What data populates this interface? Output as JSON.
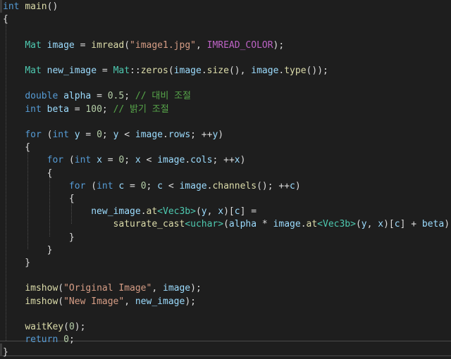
{
  "code": {
    "lines": [
      [
        {
          "c": "kw",
          "t": "int"
        },
        {
          "c": "pl",
          "t": " "
        },
        {
          "c": "fn",
          "t": "main"
        },
        {
          "c": "pl",
          "t": "()"
        }
      ],
      [
        {
          "c": "pl",
          "t": "{"
        }
      ],
      [],
      [
        {
          "c": "pl",
          "t": "    "
        },
        {
          "c": "ty",
          "t": "Mat"
        },
        {
          "c": "pl",
          "t": " "
        },
        {
          "c": "id",
          "t": "image"
        },
        {
          "c": "pl",
          "t": " = "
        },
        {
          "c": "fn",
          "t": "imread"
        },
        {
          "c": "pl",
          "t": "("
        },
        {
          "c": "st",
          "t": "\"image1.jpg\""
        },
        {
          "c": "pl",
          "t": ", "
        },
        {
          "c": "mc",
          "t": "IMREAD_COLOR"
        },
        {
          "c": "pl",
          "t": ");"
        }
      ],
      [],
      [
        {
          "c": "pl",
          "t": "    "
        },
        {
          "c": "ty",
          "t": "Mat"
        },
        {
          "c": "pl",
          "t": " "
        },
        {
          "c": "id",
          "t": "new_image"
        },
        {
          "c": "pl",
          "t": " = "
        },
        {
          "c": "ty",
          "t": "Mat"
        },
        {
          "c": "pl",
          "t": "::"
        },
        {
          "c": "fn",
          "t": "zeros"
        },
        {
          "c": "pl",
          "t": "("
        },
        {
          "c": "id",
          "t": "image"
        },
        {
          "c": "pl",
          "t": "."
        },
        {
          "c": "fn",
          "t": "size"
        },
        {
          "c": "pl",
          "t": "(), "
        },
        {
          "c": "id",
          "t": "image"
        },
        {
          "c": "pl",
          "t": "."
        },
        {
          "c": "fn",
          "t": "type"
        },
        {
          "c": "pl",
          "t": "());"
        }
      ],
      [],
      [
        {
          "c": "pl",
          "t": "    "
        },
        {
          "c": "kw",
          "t": "double"
        },
        {
          "c": "pl",
          "t": " "
        },
        {
          "c": "id",
          "t": "alpha"
        },
        {
          "c": "pl",
          "t": " = "
        },
        {
          "c": "nm",
          "t": "0.5"
        },
        {
          "c": "pl",
          "t": "; "
        },
        {
          "c": "cm",
          "t": "// 대비 조절"
        }
      ],
      [
        {
          "c": "pl",
          "t": "    "
        },
        {
          "c": "kw",
          "t": "int"
        },
        {
          "c": "pl",
          "t": " "
        },
        {
          "c": "id",
          "t": "beta"
        },
        {
          "c": "pl",
          "t": " = "
        },
        {
          "c": "nm",
          "t": "100"
        },
        {
          "c": "pl",
          "t": "; "
        },
        {
          "c": "cm",
          "t": "// 밝기 조절"
        }
      ],
      [],
      [
        {
          "c": "pl",
          "t": "    "
        },
        {
          "c": "kw",
          "t": "for"
        },
        {
          "c": "pl",
          "t": " ("
        },
        {
          "c": "kw",
          "t": "int"
        },
        {
          "c": "pl",
          "t": " "
        },
        {
          "c": "id",
          "t": "y"
        },
        {
          "c": "pl",
          "t": " = "
        },
        {
          "c": "nm",
          "t": "0"
        },
        {
          "c": "pl",
          "t": "; "
        },
        {
          "c": "id",
          "t": "y"
        },
        {
          "c": "pl",
          "t": " < "
        },
        {
          "c": "id",
          "t": "image"
        },
        {
          "c": "pl",
          "t": "."
        },
        {
          "c": "id",
          "t": "rows"
        },
        {
          "c": "pl",
          "t": "; ++"
        },
        {
          "c": "id",
          "t": "y"
        },
        {
          "c": "pl",
          "t": ")"
        }
      ],
      [
        {
          "c": "pl",
          "t": "    {"
        }
      ],
      [
        {
          "c": "pl",
          "t": "        "
        },
        {
          "c": "kw",
          "t": "for"
        },
        {
          "c": "pl",
          "t": " ("
        },
        {
          "c": "kw",
          "t": "int"
        },
        {
          "c": "pl",
          "t": " "
        },
        {
          "c": "id",
          "t": "x"
        },
        {
          "c": "pl",
          "t": " = "
        },
        {
          "c": "nm",
          "t": "0"
        },
        {
          "c": "pl",
          "t": "; "
        },
        {
          "c": "id",
          "t": "x"
        },
        {
          "c": "pl",
          "t": " < "
        },
        {
          "c": "id",
          "t": "image"
        },
        {
          "c": "pl",
          "t": "."
        },
        {
          "c": "id",
          "t": "cols"
        },
        {
          "c": "pl",
          "t": "; ++"
        },
        {
          "c": "id",
          "t": "x"
        },
        {
          "c": "pl",
          "t": ")"
        }
      ],
      [
        {
          "c": "pl",
          "t": "        {"
        }
      ],
      [
        {
          "c": "pl",
          "t": "            "
        },
        {
          "c": "kw",
          "t": "for"
        },
        {
          "c": "pl",
          "t": " ("
        },
        {
          "c": "kw",
          "t": "int"
        },
        {
          "c": "pl",
          "t": " "
        },
        {
          "c": "id",
          "t": "c"
        },
        {
          "c": "pl",
          "t": " = "
        },
        {
          "c": "nm",
          "t": "0"
        },
        {
          "c": "pl",
          "t": "; "
        },
        {
          "c": "id",
          "t": "c"
        },
        {
          "c": "pl",
          "t": " < "
        },
        {
          "c": "id",
          "t": "image"
        },
        {
          "c": "pl",
          "t": "."
        },
        {
          "c": "fn",
          "t": "channels"
        },
        {
          "c": "pl",
          "t": "(); ++"
        },
        {
          "c": "id",
          "t": "c"
        },
        {
          "c": "pl",
          "t": ")"
        }
      ],
      [
        {
          "c": "pl",
          "t": "            {"
        }
      ],
      [
        {
          "c": "pl",
          "t": "                "
        },
        {
          "c": "id",
          "t": "new_image"
        },
        {
          "c": "pl",
          "t": "."
        },
        {
          "c": "fn",
          "t": "at"
        },
        {
          "c": "ty",
          "t": "<Vec3b>"
        },
        {
          "c": "pl",
          "t": "("
        },
        {
          "c": "id",
          "t": "y"
        },
        {
          "c": "pl",
          "t": ", "
        },
        {
          "c": "id",
          "t": "x"
        },
        {
          "c": "pl",
          "t": ")["
        },
        {
          "c": "id",
          "t": "c"
        },
        {
          "c": "pl",
          "t": "] ="
        }
      ],
      [
        {
          "c": "pl",
          "t": "                    "
        },
        {
          "c": "fn",
          "t": "saturate_cast"
        },
        {
          "c": "ty",
          "t": "<uchar>"
        },
        {
          "c": "pl",
          "t": "("
        },
        {
          "c": "id",
          "t": "alpha"
        },
        {
          "c": "pl",
          "t": " * "
        },
        {
          "c": "id",
          "t": "image"
        },
        {
          "c": "pl",
          "t": "."
        },
        {
          "c": "fn",
          "t": "at"
        },
        {
          "c": "ty",
          "t": "<Vec3b>"
        },
        {
          "c": "pl",
          "t": "("
        },
        {
          "c": "id",
          "t": "y"
        },
        {
          "c": "pl",
          "t": ", "
        },
        {
          "c": "id",
          "t": "x"
        },
        {
          "c": "pl",
          "t": ")["
        },
        {
          "c": "id",
          "t": "c"
        },
        {
          "c": "pl",
          "t": "] + "
        },
        {
          "c": "id",
          "t": "beta"
        },
        {
          "c": "pl",
          "t": ");"
        }
      ],
      [
        {
          "c": "pl",
          "t": "            }"
        }
      ],
      [
        {
          "c": "pl",
          "t": "        }"
        }
      ],
      [
        {
          "c": "pl",
          "t": "    }"
        }
      ],
      [],
      [
        {
          "c": "pl",
          "t": "    "
        },
        {
          "c": "fn",
          "t": "imshow"
        },
        {
          "c": "pl",
          "t": "("
        },
        {
          "c": "st",
          "t": "\"Original Image\""
        },
        {
          "c": "pl",
          "t": ", "
        },
        {
          "c": "id",
          "t": "image"
        },
        {
          "c": "pl",
          "t": ");"
        }
      ],
      [
        {
          "c": "pl",
          "t": "    "
        },
        {
          "c": "fn",
          "t": "imshow"
        },
        {
          "c": "pl",
          "t": "("
        },
        {
          "c": "st",
          "t": "\"New Image\""
        },
        {
          "c": "pl",
          "t": ", "
        },
        {
          "c": "id",
          "t": "new_image"
        },
        {
          "c": "pl",
          "t": ");"
        }
      ],
      [],
      [
        {
          "c": "pl",
          "t": "    "
        },
        {
          "c": "fn",
          "t": "waitKey"
        },
        {
          "c": "pl",
          "t": "("
        },
        {
          "c": "nm",
          "t": "0"
        },
        {
          "c": "pl",
          "t": ");"
        }
      ],
      [
        {
          "c": "pl",
          "t": "    "
        },
        {
          "c": "kw",
          "t": "return"
        },
        {
          "c": "pl",
          "t": " "
        },
        {
          "c": "nm",
          "t": "0"
        },
        {
          "c": "pl",
          "t": ";"
        }
      ],
      [
        {
          "c": "pl",
          "t": "}"
        }
      ]
    ]
  },
  "colors": {
    "background": "#1e1e1e",
    "keyword": "#569cd6",
    "type": "#4ec9b0",
    "function": "#dcdcaa",
    "identifier": "#9cdcfe",
    "string": "#d69d85",
    "number": "#b5cea8",
    "comment": "#57a64a",
    "macro": "#bd63c5"
  }
}
